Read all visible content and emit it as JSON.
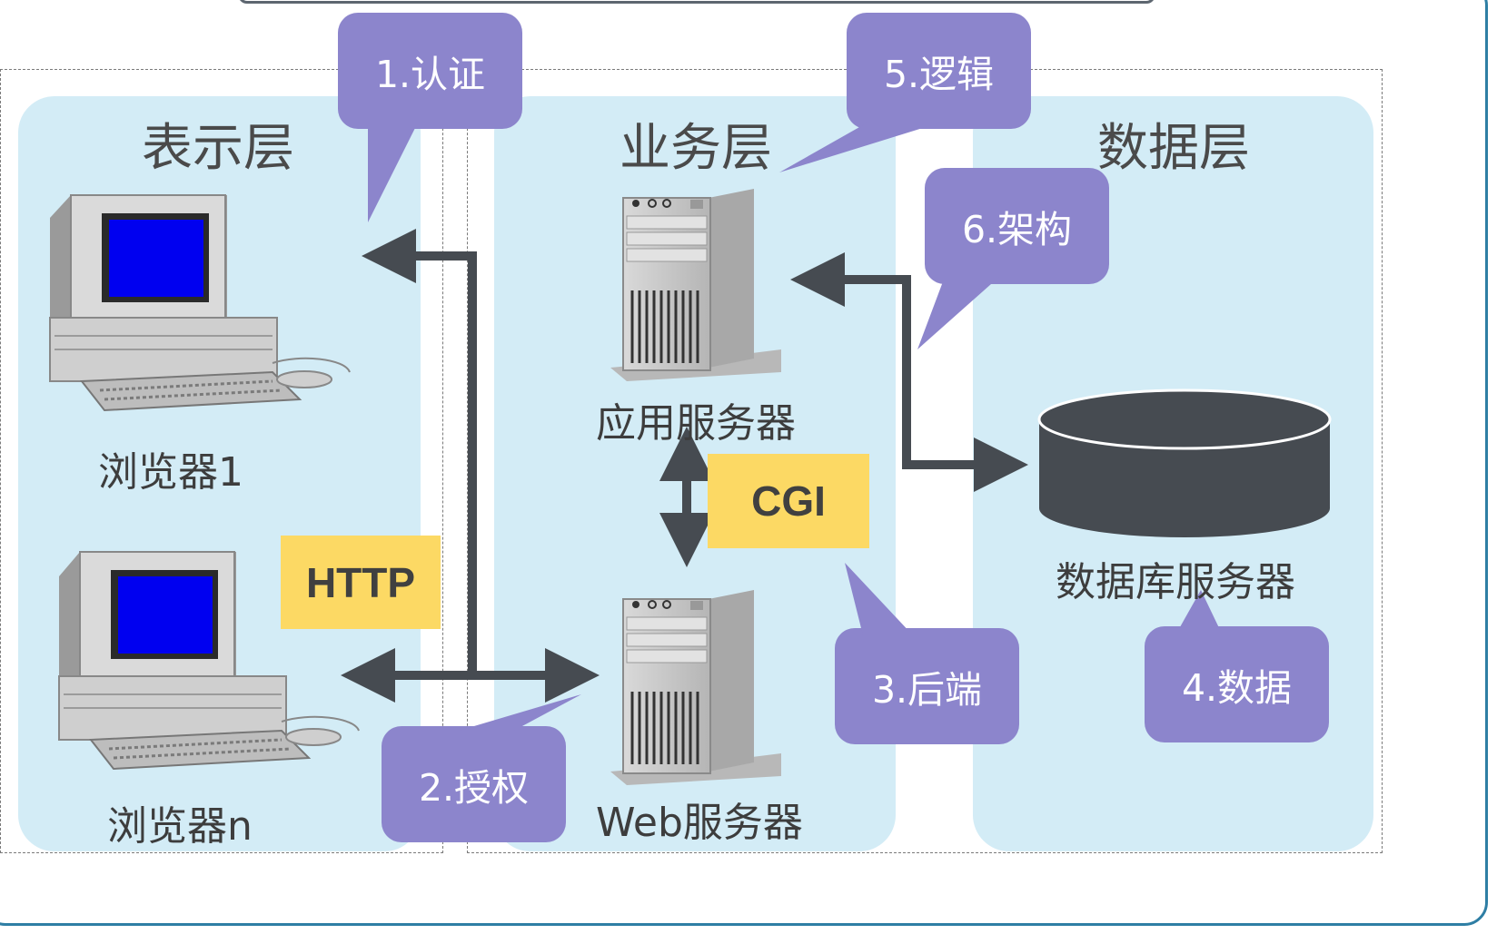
{
  "layers": [
    {
      "title": "表示层"
    },
    {
      "title": "业务层"
    },
    {
      "title": "数据层"
    }
  ],
  "nodes": {
    "browser1": "浏览器1",
    "browserN": "浏览器n",
    "app_server": "应用服务器",
    "web_server": "Web服务器",
    "db_server": "数据库服务器"
  },
  "protocols": {
    "http": "HTTP",
    "cgi": "CGI"
  },
  "callouts": [
    {
      "label": "1.认证"
    },
    {
      "label": "2.授权"
    },
    {
      "label": "3.后端"
    },
    {
      "label": "4.数据"
    },
    {
      "label": "5.逻辑"
    },
    {
      "label": "6.架构"
    }
  ],
  "colors": {
    "layer_bg": "#d3ecf6",
    "callout": "#8c85cc",
    "protocol": "#fcd964",
    "arrow": "#464b51",
    "database": "#464b51",
    "screen": "#0000f0"
  }
}
